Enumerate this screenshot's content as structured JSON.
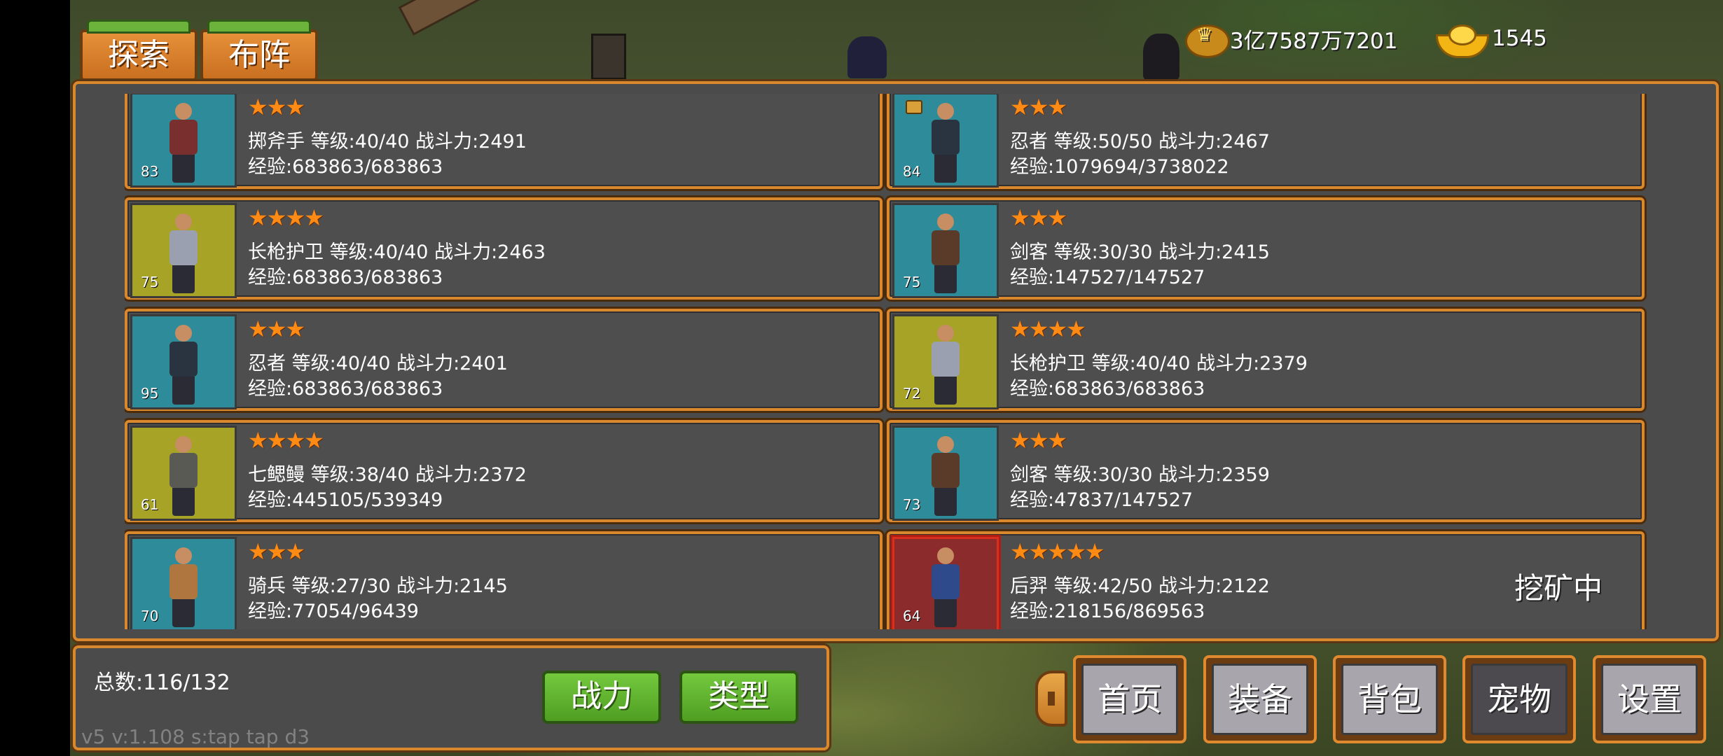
{
  "tabs": [
    {
      "label": "探索"
    },
    {
      "label": "布阵"
    }
  ],
  "currency": {
    "coins": "3亿7587万7201",
    "ingots": "1545",
    "coin_icon": "gold-coin-icon",
    "ingot_icon": "gold-ingot-icon"
  },
  "pets": [
    {
      "stars": "★★★",
      "name_line": "掷斧手 等级:40/40 战斗力:2491",
      "exp_line": "经验:683863/683863",
      "level": "83",
      "frame": "teal",
      "body_color": "#7a2f2f",
      "locked": false,
      "status": ""
    },
    {
      "stars": "★★★",
      "name_line": "忍者 等级:50/50 战斗力:2467",
      "exp_line": "经验:1079694/3738022",
      "level": "84",
      "frame": "teal",
      "body_color": "#2a3340",
      "locked": true,
      "status": ""
    },
    {
      "stars": "★★★★",
      "name_line": "长枪护卫 等级:40/40 战斗力:2463",
      "exp_line": "经验:683863/683863",
      "level": "75",
      "frame": "yellow",
      "body_color": "#9aa0b0",
      "locked": false,
      "status": ""
    },
    {
      "stars": "★★★",
      "name_line": "剑客 等级:30/30 战斗力:2415",
      "exp_line": "经验:147527/147527",
      "level": "75",
      "frame": "teal",
      "body_color": "#5a3b2a",
      "locked": false,
      "status": ""
    },
    {
      "stars": "★★★",
      "name_line": "忍者 等级:40/40 战斗力:2401",
      "exp_line": "经验:683863/683863",
      "level": "95",
      "frame": "teal",
      "body_color": "#2a3340",
      "locked": false,
      "status": ""
    },
    {
      "stars": "★★★★",
      "name_line": "长枪护卫 等级:40/40 战斗力:2379",
      "exp_line": "经验:683863/683863",
      "level": "72",
      "frame": "yellow",
      "body_color": "#9aa0b0",
      "locked": false,
      "status": ""
    },
    {
      "stars": "★★★★",
      "name_line": "七鳃鳗 等级:38/40 战斗力:2372",
      "exp_line": "经验:445105/539349",
      "level": "61",
      "frame": "yellow",
      "body_color": "#5a5a55",
      "locked": false,
      "status": ""
    },
    {
      "stars": "★★★",
      "name_line": "剑客 等级:30/30 战斗力:2359",
      "exp_line": "经验:47837/147527",
      "level": "73",
      "frame": "teal",
      "body_color": "#5a3b2a",
      "locked": false,
      "status": ""
    },
    {
      "stars": "★★★",
      "name_line": "骑兵 等级:27/30 战斗力:2145",
      "exp_line": "经验:77054/96439",
      "level": "70",
      "frame": "teal",
      "body_color": "#b0763f",
      "locked": false,
      "status": ""
    },
    {
      "stars": "★★★★★",
      "name_line": "后羿 等级:42/50 战斗力:2122",
      "exp_line": "经验:218156/869563",
      "level": "64",
      "frame": "red",
      "body_color": "#2f4a8a",
      "locked": false,
      "status": "挖矿中"
    }
  ],
  "footer": {
    "total": "总数:116/132",
    "sort_power": "战力",
    "sort_type": "类型",
    "version": "v5  v:1.108  s:tap  tap  d3"
  },
  "nav": [
    {
      "label": "首页",
      "active": false
    },
    {
      "label": "装备",
      "active": false
    },
    {
      "label": "背包",
      "active": false
    },
    {
      "label": "宠物",
      "active": true
    },
    {
      "label": "设置",
      "active": false
    }
  ],
  "colors": {
    "accent_orange": "#d9882e",
    "star": "#ff8a14",
    "button_green": "#5fae2c",
    "panel": "#4b4b4b"
  }
}
